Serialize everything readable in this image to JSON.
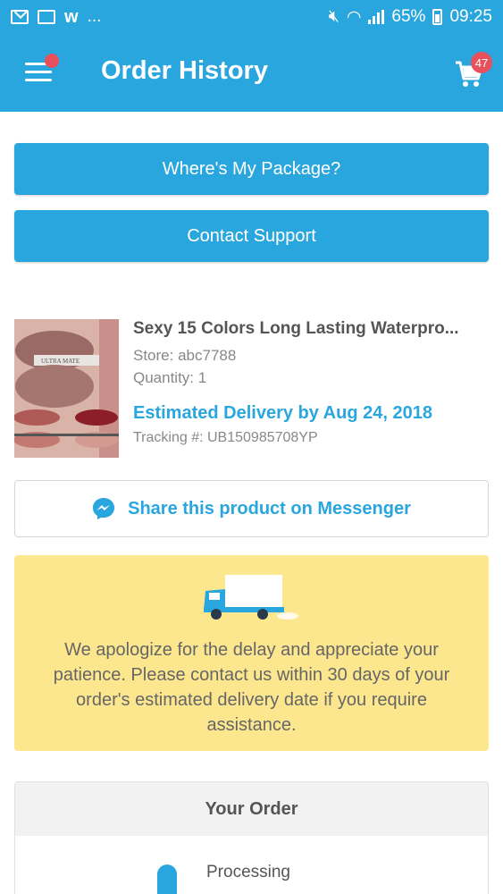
{
  "status_bar": {
    "notif": "...",
    "battery": "65%",
    "time": "09:25"
  },
  "header": {
    "title": "Order History",
    "cart_count": "47"
  },
  "actions": {
    "where_package": "Where's My Package?",
    "contact_support": "Contact Support"
  },
  "product": {
    "title": "Sexy 15 Colors Long Lasting Waterpro...",
    "store": "Store: abc7788",
    "quantity": "Quantity: 1",
    "estimated_delivery": "Estimated Delivery by Aug 24, 2018",
    "tracking": "Tracking #: UB150985708YP",
    "image_label": "ULTRA MATE"
  },
  "share": {
    "label": "Share this product on Messenger"
  },
  "notice": {
    "text": "We apologize for the delay and appreciate your patience. Please contact us within 30 days of your order's estimated delivery date if you require assistance."
  },
  "order": {
    "heading": "Your Order",
    "step_label": "Processing"
  },
  "colors": {
    "primary": "#2aa6de",
    "badge": "#e8505b",
    "notice_bg": "#fce78f"
  }
}
